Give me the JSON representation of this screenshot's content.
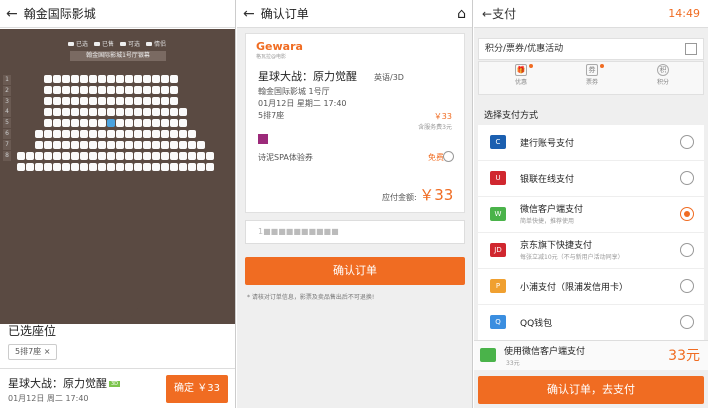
{
  "panel1": {
    "title": "翰金国际影城",
    "legend": [
      "已选",
      "已售",
      "可选",
      "情侣"
    ],
    "screen": "翰金国际影城1号厅银幕",
    "rows": [
      "1",
      "2",
      "3",
      "4",
      "5",
      "6",
      "7",
      "8"
    ],
    "selected_label": "已选座位",
    "seat_chip": "5排7座",
    "movie": "星球大战：原力觉醒",
    "tag": "3D",
    "datetime": "01月12日 周二 17:40",
    "confirm": "确定 ￥33"
  },
  "panel2": {
    "title": "确认订单",
    "brand": "Gewara",
    "brand_sub": "格瓦拉@电影",
    "movie": "星球大战：原力觉醒",
    "lang": "英语/3D",
    "cinema": "翰金国际影城 1号厅",
    "datetime": "01月12日 星期二 17:40",
    "seat": "5排7座",
    "price": "￥33",
    "fee": "含服务费3元",
    "coupon": "诗泥SPA体验券",
    "free": "免费",
    "total_label": "应付金额:",
    "total": "￥33",
    "phone_placeholder": "1■■■■■■■■■■",
    "confirm": "确认订单",
    "note": "* 请核对订单信息，影票及卖品售出后不可退换!"
  },
  "panel3": {
    "title": "支付",
    "time": "14:49",
    "promo_label": "积分/票券/优惠活动",
    "promo_tabs": [
      {
        "label": "优惠",
        "glyph": "🎁"
      },
      {
        "label": "票券",
        "glyph": "券"
      },
      {
        "label": "积分",
        "glyph": "积"
      }
    ],
    "choose_label": "选择支付方式",
    "methods": [
      {
        "label": "建行账号支付",
        "sub": "",
        "color": "#1b5fb0",
        "glyph": "C"
      },
      {
        "label": "银联在线支付",
        "sub": "",
        "color": "#d0272f",
        "glyph": "U"
      },
      {
        "label": "微信客户端支付",
        "sub": "简单快捷，推荐使用",
        "color": "#4ab34a",
        "glyph": "W"
      },
      {
        "label": "京东旗下快捷支付",
        "sub": "每张立减10元（不与新用户活动同享）",
        "color": "#d0272f",
        "glyph": "JD"
      },
      {
        "label": "小浦支付（限浦发信用卡）",
        "sub": "",
        "color": "#f0a030",
        "glyph": "P"
      },
      {
        "label": "QQ钱包",
        "sub": "",
        "color": "#3a8ee0",
        "glyph": "Q"
      }
    ],
    "selected_method": 2,
    "paybar_label": "使用微信客户端支付",
    "paybar_sub": "33元",
    "paybar_amount": "33元",
    "confirm": "确认订单，去支付"
  }
}
